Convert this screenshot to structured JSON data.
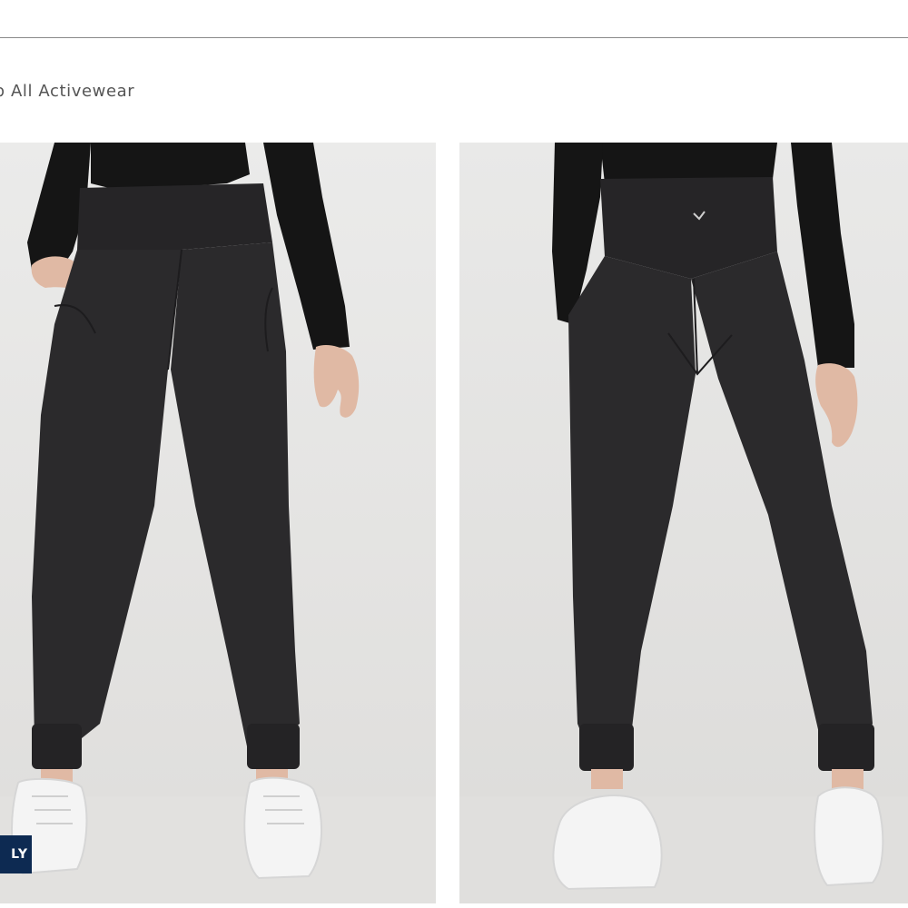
{
  "header": {
    "shop_link_label": "op All Activewear"
  },
  "gallery": {
    "images": [
      {
        "name": "front-view",
        "alt": ""
      },
      {
        "name": "back-view",
        "alt": ""
      }
    ],
    "badge_label": "LY"
  },
  "colors": {
    "garment": "#2b2a2c",
    "top": "#151515",
    "background": "#e7e7e5",
    "badge": "#0d2a52"
  }
}
